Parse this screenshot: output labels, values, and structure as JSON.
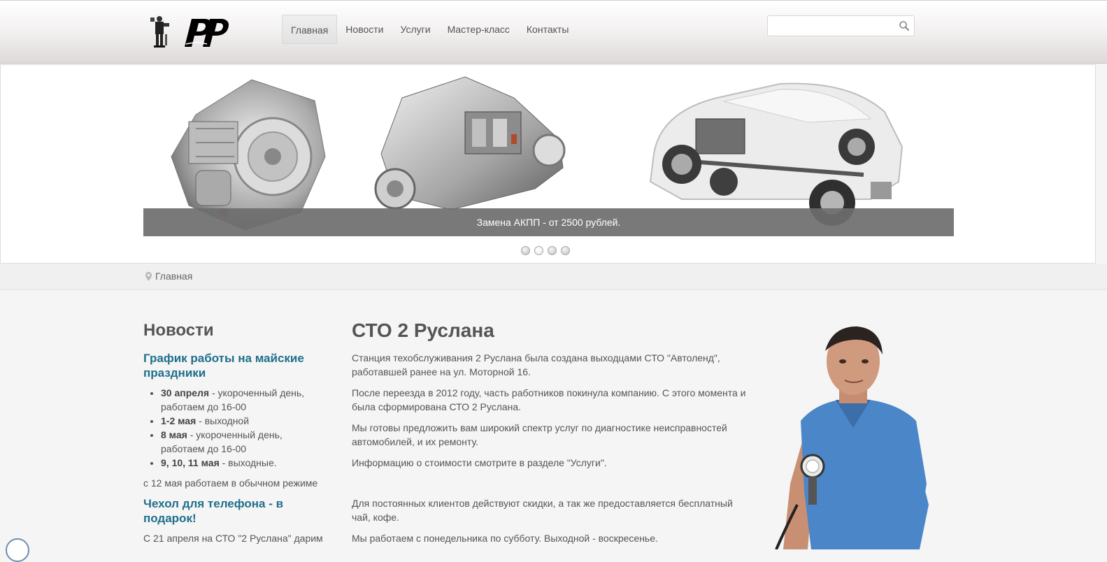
{
  "nav": {
    "items": [
      {
        "label": "Главная",
        "active": true
      },
      {
        "label": "Новости",
        "active": false
      },
      {
        "label": "Услуги",
        "active": false
      },
      {
        "label": "Мастер-класс",
        "active": false
      },
      {
        "label": "Контакты",
        "active": false
      }
    ]
  },
  "search": {
    "placeholder": "",
    "value": "",
    "icon": "search-icon"
  },
  "slider": {
    "caption": "Замена АКПП - от 2500 рублей.",
    "dots": [
      false,
      true,
      false,
      false
    ]
  },
  "breadcrumb": {
    "icon": "location-pin-icon",
    "label": "Главная"
  },
  "news": {
    "heading": "Новости",
    "item1": {
      "title": "График работы на майские праздники",
      "list": [
        {
          "bold": "30 апреля",
          "text": " - укороченный день, работаем до 16-00"
        },
        {
          "bold": "1-2 мая",
          "text": " - выходной"
        },
        {
          "bold": "8 мая",
          "text": " - укороченный день, работаем до 16-00"
        },
        {
          "bold": "9, 10, 11 мая",
          "text": " - выходные."
        }
      ],
      "note": "с 12 мая работаем в обычном режиме"
    },
    "item2": {
      "title": "Чехол для телефона - в подарок!",
      "text": "С 21 апреля на СТО \"2 Руслана\" дарим"
    }
  },
  "main": {
    "title": "СТО 2 Руслана",
    "paragraphs": [
      "Станция техобслуживания 2 Руслана была создана выходцами СТО \"Автоленд\", работавшей ранее на ул. Моторной 16.",
      "После переезда в 2012 году, часть работников покинула компанию. С этого момента и была сформирована СТО 2 Руслана.",
      "Мы готовы предложить вам широкий спектр услуг по диагностике неисправностей автомобилей, и их ремонту.",
      "Информацию о стоимости смотрите в разделе \"Услуги\".",
      "Для постоянных клиентов действуют скидки, а так же предоставляется бесплатный чай, кофе.",
      "Мы работаем с понедельника по субботу. Выходной - воскресенье."
    ]
  },
  "colors": {
    "link": "#1f6f8b",
    "text": "#555555",
    "caption_bg": "#6e6e6e",
    "mechanic_shirt": "#4a86c8"
  }
}
